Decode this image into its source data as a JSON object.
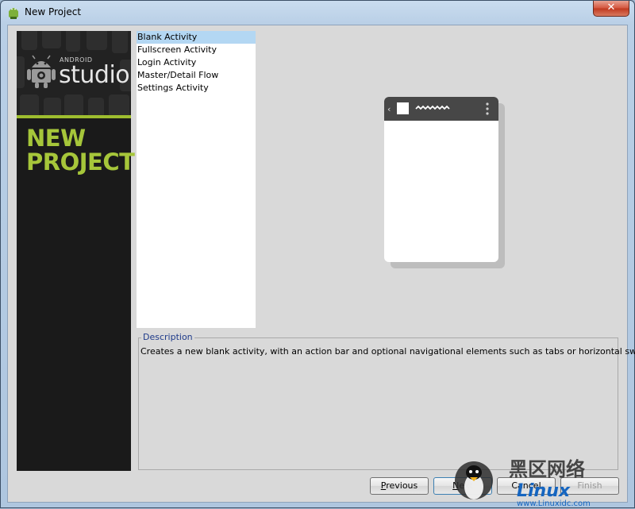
{
  "window": {
    "title": "New Project",
    "close_glyph": "✕"
  },
  "banner": {
    "small_text": "ANDROID",
    "brand": "studio",
    "heading_line1": "NEW",
    "heading_line2": "PROJECT"
  },
  "templates": {
    "items": [
      "Blank Activity",
      "Fullscreen Activity",
      "Login Activity",
      "Master/Detail Flow",
      "Settings Activity"
    ],
    "selected_index": 0
  },
  "preview": {
    "icon": "phone-preview-icon"
  },
  "description": {
    "legend": "Description",
    "text": "Creates a new blank activity, with an action bar and optional navigational elements such as tabs or horizontal swipe."
  },
  "buttons": {
    "previous": {
      "mnemonic": "P",
      "rest": "revious"
    },
    "next": {
      "mnemonic": "N",
      "rest": "ext"
    },
    "cancel": "Cancel",
    "finish": "Finish"
  },
  "watermark": {
    "cn": "黑区网络",
    "brand": "Linux",
    "site": "www.Linuxidc.com"
  },
  "colors": {
    "accent_green": "#a6c63a",
    "banner_bg": "#1a1a1a",
    "selection": "#b3d7f3",
    "legend_blue": "#1f3b8a"
  }
}
